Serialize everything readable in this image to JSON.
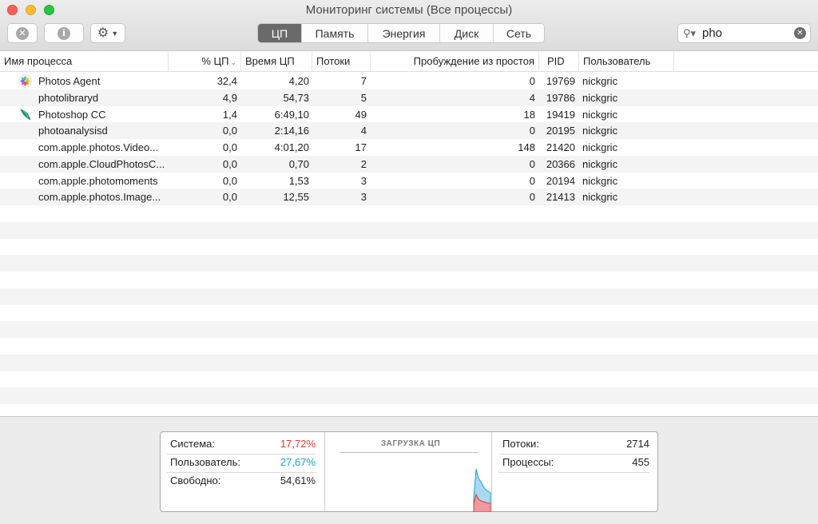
{
  "window": {
    "title": "Мониторинг системы (Все процессы)"
  },
  "toolbar": {
    "tabs": [
      {
        "label": "ЦП",
        "active": true
      },
      {
        "label": "Память",
        "active": false
      },
      {
        "label": "Энергия",
        "active": false
      },
      {
        "label": "Диск",
        "active": false
      },
      {
        "label": "Сеть",
        "active": false
      }
    ],
    "search_value": "pho"
  },
  "table": {
    "columns": [
      "Имя процесса",
      "% ЦП",
      "Время ЦП",
      "Потоки",
      "Пробуждение из простоя",
      "PID",
      "Пользователь"
    ],
    "rows": [
      {
        "name": "Photos Agent",
        "cpu": "32,4",
        "time": "4,20",
        "threads": "7",
        "wakeups": "0",
        "pid": "19769",
        "user": "nickgric",
        "icon": "photos-icon"
      },
      {
        "name": "photolibraryd",
        "cpu": "4,9",
        "time": "54,73",
        "threads": "5",
        "wakeups": "4",
        "pid": "19786",
        "user": "nickgric",
        "icon": ""
      },
      {
        "name": "Photoshop CC",
        "cpu": "1,4",
        "time": "6:49,10",
        "threads": "49",
        "wakeups": "18",
        "pid": "19419",
        "user": "nickgric",
        "icon": "feather-icon"
      },
      {
        "name": "photoanalysisd",
        "cpu": "0,0",
        "time": "2:14,16",
        "threads": "4",
        "wakeups": "0",
        "pid": "20195",
        "user": "nickgric",
        "icon": ""
      },
      {
        "name": "com.apple.photos.Video...",
        "cpu": "0,0",
        "time": "4:01,20",
        "threads": "17",
        "wakeups": "148",
        "pid": "21420",
        "user": "nickgric",
        "icon": ""
      },
      {
        "name": "com.apple.CloudPhotosC...",
        "cpu": "0,0",
        "time": "0,70",
        "threads": "2",
        "wakeups": "0",
        "pid": "20366",
        "user": "nickgric",
        "icon": ""
      },
      {
        "name": "com.apple.photomoments",
        "cpu": "0,0",
        "time": "1,53",
        "threads": "3",
        "wakeups": "0",
        "pid": "20194",
        "user": "nickgric",
        "icon": ""
      },
      {
        "name": "com.apple.photos.Image...",
        "cpu": "0,0",
        "time": "12,55",
        "threads": "3",
        "wakeups": "0",
        "pid": "21413",
        "user": "nickgric",
        "icon": ""
      }
    ]
  },
  "summary": {
    "system_label": "Система:",
    "system_value": "17,72%",
    "system_color": "#e0392f",
    "user_label": "Пользователь:",
    "user_value": "27,67%",
    "user_color": "#1e9fd8",
    "idle_label": "Свободно:",
    "idle_value": "54,61%",
    "graph_title": "ЗАГРУЗКА ЦП",
    "threads_label": "Потоки:",
    "threads_value": "2714",
    "processes_label": "Процессы:",
    "processes_value": "455"
  }
}
